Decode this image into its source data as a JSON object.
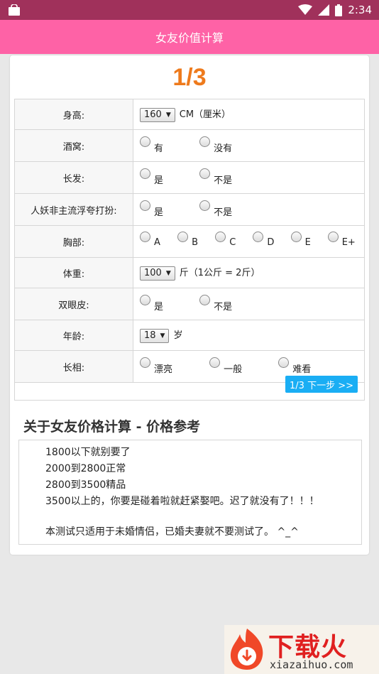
{
  "status_bar": {
    "time": "2:34"
  },
  "app_bar": {
    "title": "女友价值计算"
  },
  "page_indicator": "1/3",
  "form": {
    "height": {
      "label": "身高:",
      "value": "160",
      "unit": "CM（厘米）"
    },
    "dimples": {
      "label": "酒窝:",
      "options": [
        "有",
        "没有"
      ]
    },
    "long_hair": {
      "label": "长发:",
      "options": [
        "是",
        "不是"
      ]
    },
    "dress_style": {
      "label": "人妖非主流浮夸打扮:",
      "options": [
        "是",
        "不是"
      ]
    },
    "chest": {
      "label": "胸部:",
      "options": [
        "A",
        "B",
        "C",
        "D",
        "E",
        "E+"
      ]
    },
    "weight": {
      "label": "体重:",
      "value": "100",
      "unit": "斤（1公斤 = 2斤）"
    },
    "double_eyelid": {
      "label": "双眼皮:",
      "options": [
        "是",
        "不是"
      ]
    },
    "age": {
      "label": "年龄:",
      "value": "18",
      "unit": "岁"
    },
    "looks": {
      "label": "长相:",
      "options": [
        "漂亮",
        "一般",
        "难看"
      ]
    }
  },
  "next_button": "1/3 下一步 >>",
  "about": {
    "title": "关于女友价格计算 - 价格参考",
    "lines": [
      "1800以下就别要了",
      "2000到2800正常",
      "2800到3500精品",
      "3500以上的，你要是碰着啦就赶紧娶吧。迟了就没有了！！！",
      "本测试只适用于未婚情侣，已婚夫妻就不要测试了。 ^_^"
    ]
  },
  "watermark": {
    "text": "下载火",
    "url": "xiazaihuo.com"
  }
}
